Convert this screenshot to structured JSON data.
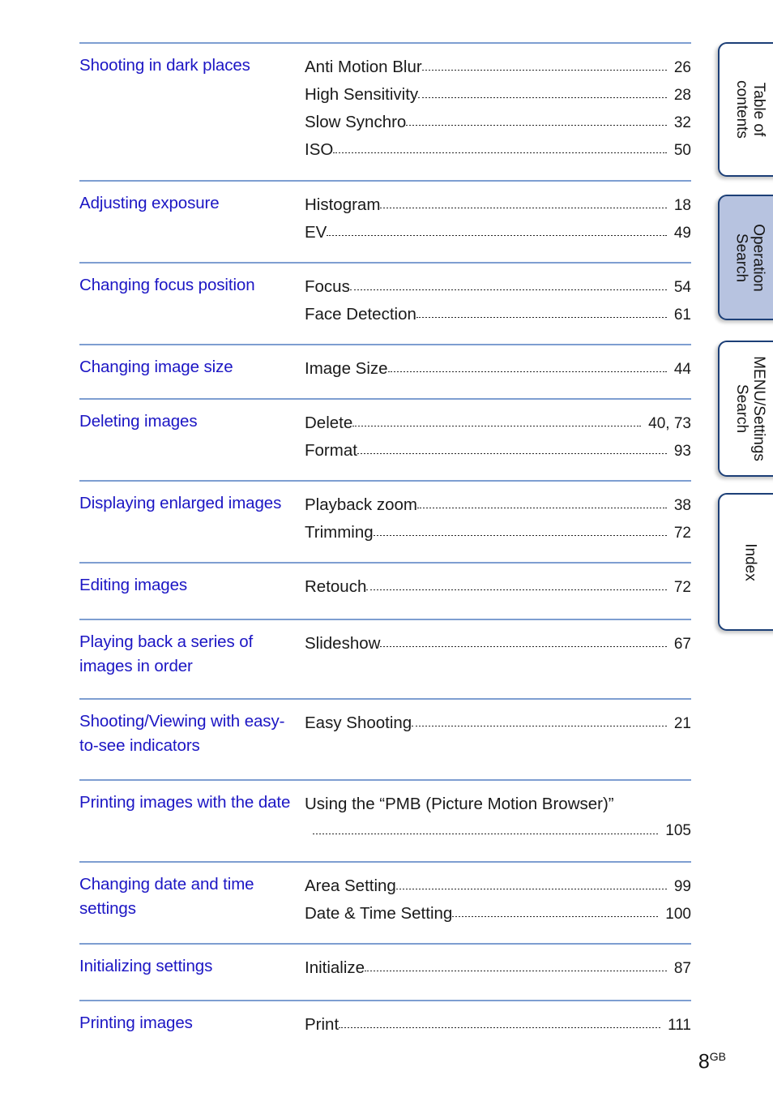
{
  "document": {
    "page_number": "8",
    "page_number_suffix": "GB"
  },
  "side_tabs": [
    {
      "id": "table-of-contents",
      "label": "Table of\ncontents",
      "line1": "Table of",
      "line2": "contents",
      "active": false
    },
    {
      "id": "operation-search",
      "label": "Operation Search",
      "line1": "Operation",
      "line2": "Search",
      "active": true
    },
    {
      "id": "menu-settings-search",
      "label": "MENU/Settings Search",
      "line1": "MENU/Settings",
      "line2": "Search",
      "active": false
    },
    {
      "id": "index",
      "label": "Index",
      "line1": "Index",
      "line2": "",
      "active": false
    }
  ],
  "colors": {
    "heading_blue": "#1c16c4",
    "rule_blue": "#7e9ed1",
    "tab_border": "#1c3f77",
    "tab_active_fill": "#b7c3e0",
    "body_text": "#1a1a1a"
  },
  "toc": [
    {
      "category": "Shooting in dark places",
      "entries": [
        {
          "title": "Anti Motion Blur",
          "page": "26"
        },
        {
          "title": "High Sensitivity",
          "page": "28"
        },
        {
          "title": "Slow Synchro",
          "page": "32"
        },
        {
          "title": "ISO",
          "page": "50"
        }
      ]
    },
    {
      "category": "Adjusting exposure",
      "entries": [
        {
          "title": "Histogram",
          "page": "18"
        },
        {
          "title": "EV",
          "page": "49"
        }
      ]
    },
    {
      "category": "Changing focus position",
      "entries": [
        {
          "title": "Focus",
          "page": "54"
        },
        {
          "title": "Face Detection",
          "page": "61"
        }
      ]
    },
    {
      "category": "Changing image size",
      "entries": [
        {
          "title": "Image Size",
          "page": "44"
        }
      ]
    },
    {
      "category": "Deleting images",
      "entries": [
        {
          "title": "Delete",
          "page": "40, 73"
        },
        {
          "title": "Format",
          "page": "93"
        }
      ]
    },
    {
      "category": "Displaying enlarged images",
      "entries": [
        {
          "title": "Playback zoom",
          "page": "38"
        },
        {
          "title": "Trimming",
          "page": "72"
        }
      ]
    },
    {
      "category": "Editing images",
      "entries": [
        {
          "title": "Retouch",
          "page": "72"
        }
      ]
    },
    {
      "category": "Playing back a series of images in order",
      "entries": [
        {
          "title": "Slideshow",
          "page": "67"
        }
      ]
    },
    {
      "category": "Shooting/Viewing with easy-to-see indicators",
      "entries": [
        {
          "title": "Easy Shooting",
          "page": "21"
        }
      ]
    },
    {
      "category": "Printing images with the date",
      "entries": [
        {
          "title": "Using the “PMB (Picture Motion Browser)”",
          "page": "105",
          "wrapped": true
        }
      ]
    },
    {
      "category": "Changing date and time settings",
      "entries": [
        {
          "title": "Area Setting",
          "page": "99"
        },
        {
          "title": "Date & Time Setting",
          "page": "100"
        }
      ]
    },
    {
      "category": "Initializing settings",
      "entries": [
        {
          "title": "Initialize",
          "page": "87"
        }
      ]
    },
    {
      "category": "Printing images",
      "entries": [
        {
          "title": "Print",
          "page": "111"
        }
      ]
    }
  ]
}
